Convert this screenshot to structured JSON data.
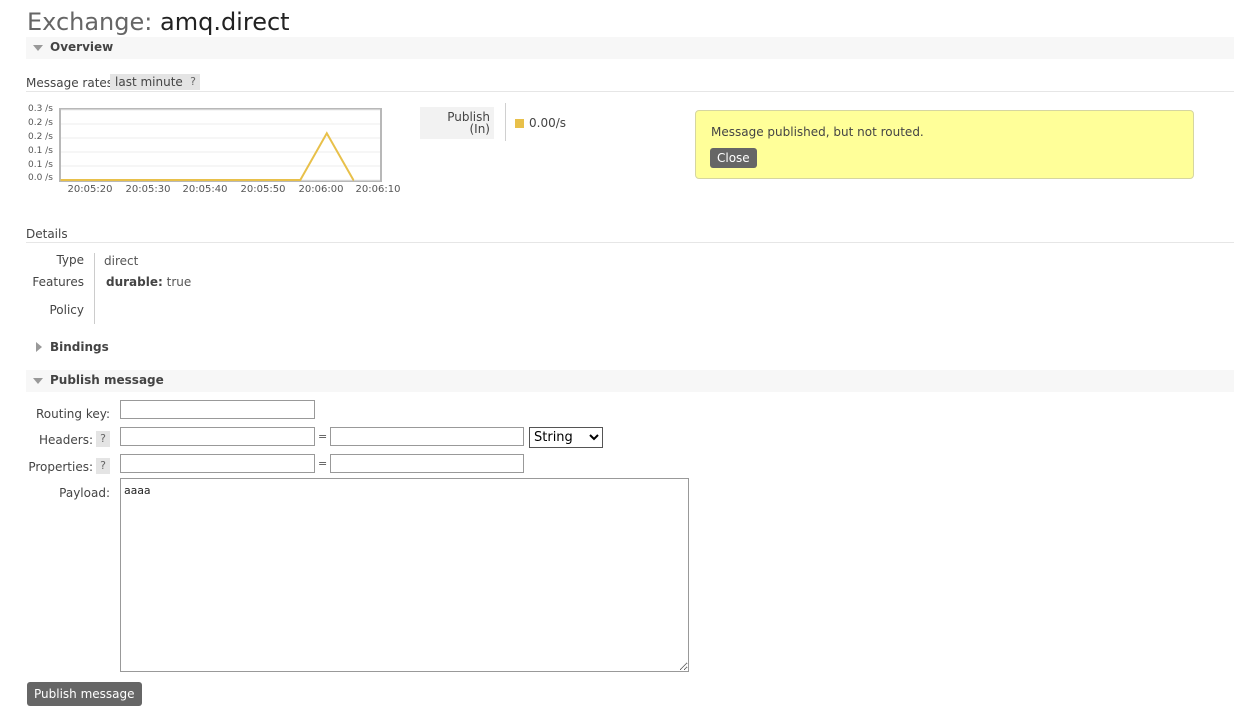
{
  "page": {
    "title_label": "Exchange:",
    "title_value": "amq.direct"
  },
  "overview": {
    "section_label": "Overview",
    "message_rates_label": "Message rates",
    "range_chip": "last minute",
    "help": "?",
    "legend": {
      "label_line1": "Publish",
      "label_line2": "(In)",
      "value": "0.00/s",
      "color": "#e8c04a"
    }
  },
  "chart_data": {
    "type": "line",
    "title": "",
    "xlabel": "",
    "ylabel": "",
    "y_tick_labels": [
      "0.3 /s",
      "0.2 /s",
      "0.2 /s",
      "0.1 /s",
      "0.1 /s",
      "0.0 /s"
    ],
    "x_tick_labels": [
      "20:05:20",
      "20:05:30",
      "20:05:40",
      "20:05:50",
      "20:06:00",
      "20:06:10"
    ],
    "ylim": [
      0,
      0.3
    ],
    "xlim_seconds": [
      15,
      75
    ],
    "grid": true,
    "series": [
      {
        "name": "Publish (In)",
        "color": "#e8c04a",
        "points": [
          [
            15,
            0
          ],
          [
            20,
            0
          ],
          [
            30,
            0
          ],
          [
            40,
            0
          ],
          [
            50,
            0
          ],
          [
            60,
            0
          ],
          [
            65,
            0.2
          ],
          [
            70,
            0
          ]
        ]
      }
    ]
  },
  "notification": {
    "text": "Message published, but not routed.",
    "close_label": "Close"
  },
  "details": {
    "section_label": "Details",
    "type_label": "Type",
    "type_value": "direct",
    "features_label": "Features",
    "durable_key": "durable:",
    "durable_value": "true",
    "policy_label": "Policy"
  },
  "bindings": {
    "section_label": "Bindings"
  },
  "publish": {
    "section_label": "Publish message",
    "routing_key_label": "Routing key:",
    "routing_key_value": "",
    "headers_label": "Headers:",
    "headers_key_value": "",
    "headers_value_value": "",
    "headers_type_options": [
      "String"
    ],
    "headers_type_selected": "String",
    "properties_label": "Properties:",
    "properties_key_value": "",
    "properties_value_value": "",
    "equals": "=",
    "payload_label": "Payload:",
    "payload_value": "aaaa",
    "help": "?",
    "submit_label": "Publish message"
  }
}
